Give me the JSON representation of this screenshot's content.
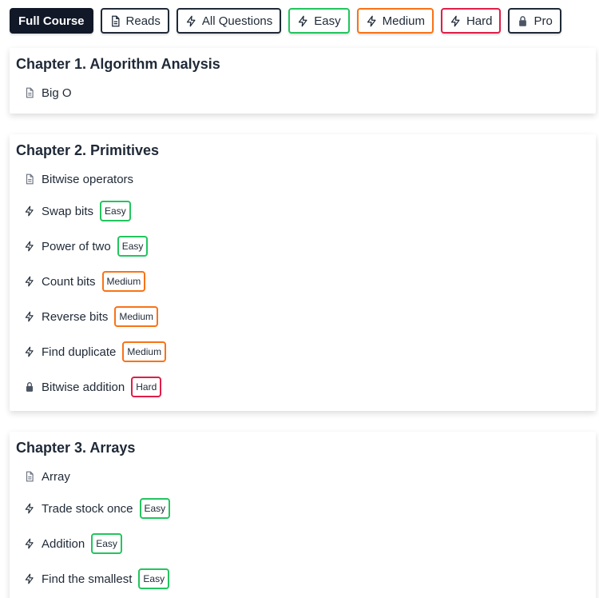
{
  "filters": [
    {
      "label": "Full Course",
      "icon": "",
      "variant": "active"
    },
    {
      "label": "Reads",
      "icon": "document-icon",
      "variant": ""
    },
    {
      "label": "All Questions",
      "icon": "lightning-icon",
      "variant": ""
    },
    {
      "label": "Easy",
      "icon": "lightning-icon",
      "variant": "easy"
    },
    {
      "label": "Medium",
      "icon": "lightning-icon",
      "variant": "medium"
    },
    {
      "label": "Hard",
      "icon": "lightning-icon",
      "variant": "hard"
    },
    {
      "label": "Pro",
      "icon": "lock-icon",
      "variant": ""
    }
  ],
  "chapters": [
    {
      "title": "Chapter 1. Algorithm Analysis",
      "items": [
        {
          "label": "Big O",
          "icon": "document-icon",
          "difficulty": ""
        }
      ]
    },
    {
      "title": "Chapter 2. Primitives",
      "items": [
        {
          "label": "Bitwise operators",
          "icon": "document-icon",
          "difficulty": ""
        },
        {
          "label": "Swap bits",
          "icon": "lightning-icon",
          "difficulty": "Easy"
        },
        {
          "label": "Power of two",
          "icon": "lightning-icon",
          "difficulty": "Easy"
        },
        {
          "label": "Count bits",
          "icon": "lightning-icon",
          "difficulty": "Medium"
        },
        {
          "label": "Reverse bits",
          "icon": "lightning-icon",
          "difficulty": "Medium"
        },
        {
          "label": "Find duplicate",
          "icon": "lightning-icon",
          "difficulty": "Medium"
        },
        {
          "label": "Bitwise addition",
          "icon": "lock-icon",
          "difficulty": "Hard"
        }
      ]
    },
    {
      "title": "Chapter 3. Arrays",
      "items": [
        {
          "label": "Array",
          "icon": "document-icon",
          "difficulty": ""
        },
        {
          "label": "Trade stock once",
          "icon": "lightning-icon",
          "difficulty": "Easy"
        },
        {
          "label": "Addition",
          "icon": "lightning-icon",
          "difficulty": "Easy"
        },
        {
          "label": "Find the smallest",
          "icon": "lightning-icon",
          "difficulty": "Easy"
        }
      ]
    }
  ],
  "colors": {
    "easy": "#22c55e",
    "medium": "#f97316",
    "hard": "#e11d48",
    "active": "#111827"
  }
}
